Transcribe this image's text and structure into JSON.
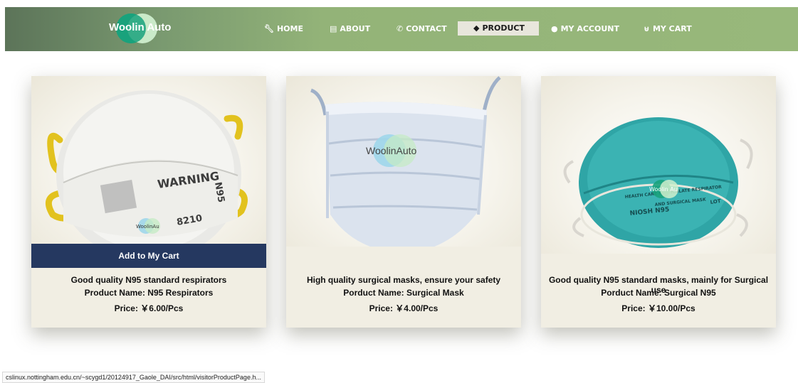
{
  "brand": {
    "name": "Woolin Auto"
  },
  "nav": [
    {
      "label": "HOME",
      "icon": "wrench-icon"
    },
    {
      "label": "ABOUT",
      "icon": "document-icon"
    },
    {
      "label": "CONTACT",
      "icon": "phone-icon"
    },
    {
      "label": "PRODUCT",
      "icon": "tag-icon",
      "active": true
    },
    {
      "label": "MY ACCOUNT",
      "icon": "user-icon"
    },
    {
      "label": "MY CART",
      "icon": "basket-icon"
    }
  ],
  "cards": [
    {
      "watermark": "WoolinAu",
      "cart_label": "Add to My Cart",
      "headline": "Good quality N95 standard respirators",
      "name": "Product Name: N95 Respirators",
      "price": "Price: ￥6.00/Pcs",
      "mask_print": [
        "WARNING",
        "N95",
        "8210"
      ]
    },
    {
      "watermark": "WoolinAuto",
      "headline": "High quality surgical masks, ensure your safety",
      "name": "Porduct Name: Surgical Mask",
      "price": "Price: ￥4.00/Pcs"
    },
    {
      "watermark": "Woolin Au",
      "headline": "Good quality N95 standard masks, mainly for Surgical use",
      "name": "Porduct Name: Surgical N95",
      "price": "Price: ￥10.00/Pcs",
      "mask_print": [
        "HEALTH CARE PARTICULATE RESPIRATOR",
        "AND SURGICAL MASK",
        "NIOSH N95",
        "LOT"
      ]
    }
  ],
  "status_bar": "cslinux.nottingham.edu.cn/~scygd1/20124917_Gaole_DAI/src/html/visitorProductPage.h..."
}
